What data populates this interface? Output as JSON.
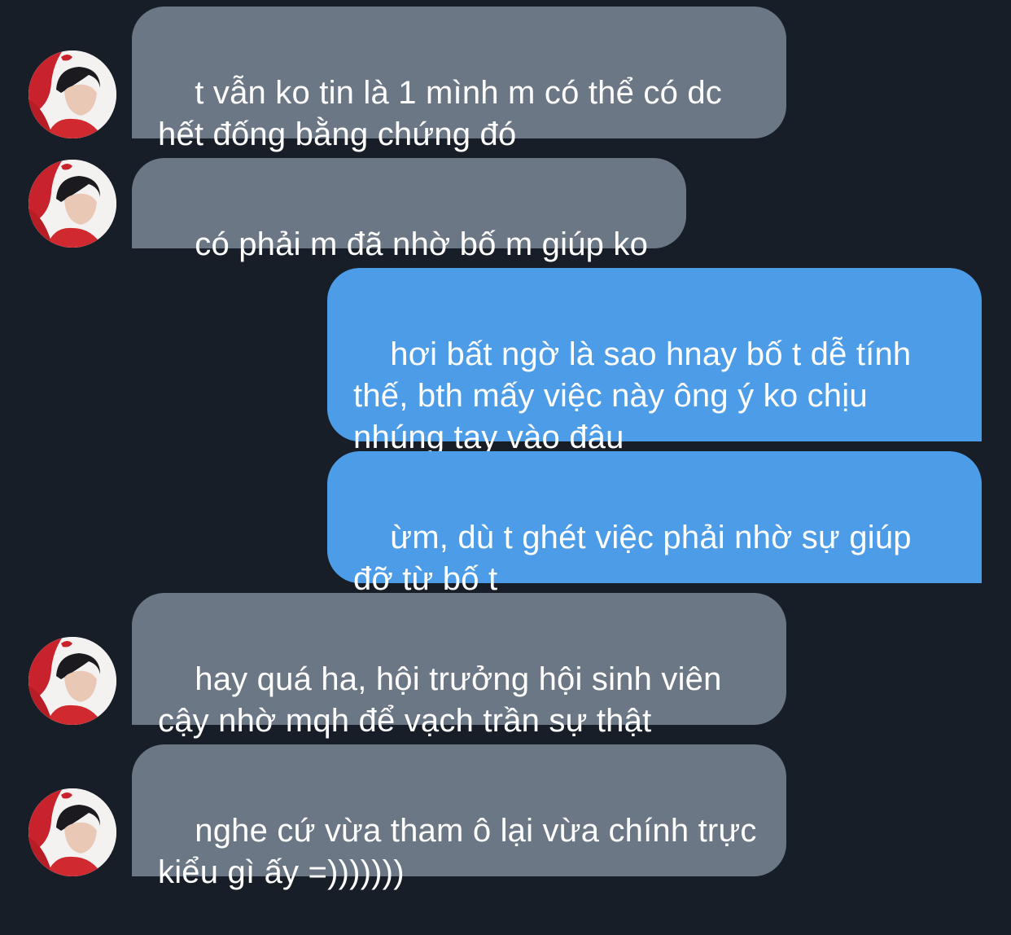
{
  "conversation": {
    "messages": [
      {
        "sender": "other",
        "text": "t vẫn ko tin là 1 mình m có thể có dc\nhết đống bằng chứng đó"
      },
      {
        "sender": "other",
        "text": "có phải m đã nhờ bố m giúp ko"
      },
      {
        "sender": "me",
        "text": "hơi bất ngờ là sao hnay bố t dễ tính\nthế, bth mấy việc này ông ý ko chịu\nnhúng tay vào đâu"
      },
      {
        "sender": "me",
        "text": "ừm, dù t ghét việc phải nhờ sự giúp\nđỡ từ bố t"
      },
      {
        "sender": "other",
        "text": "hay quá ha, hội trưởng hội sinh viên\ncậy nhờ mqh để vạch trần sự thật"
      },
      {
        "sender": "other",
        "text": "nghe cứ vừa tham ô lại vừa chính trực\nkiểu gì ấy =)))))))"
      }
    ]
  },
  "colors": {
    "background": "#171e28",
    "incoming_bubble": "#6b7785",
    "outgoing_bubble": "#4d9ce8",
    "text": "#ffffff"
  }
}
